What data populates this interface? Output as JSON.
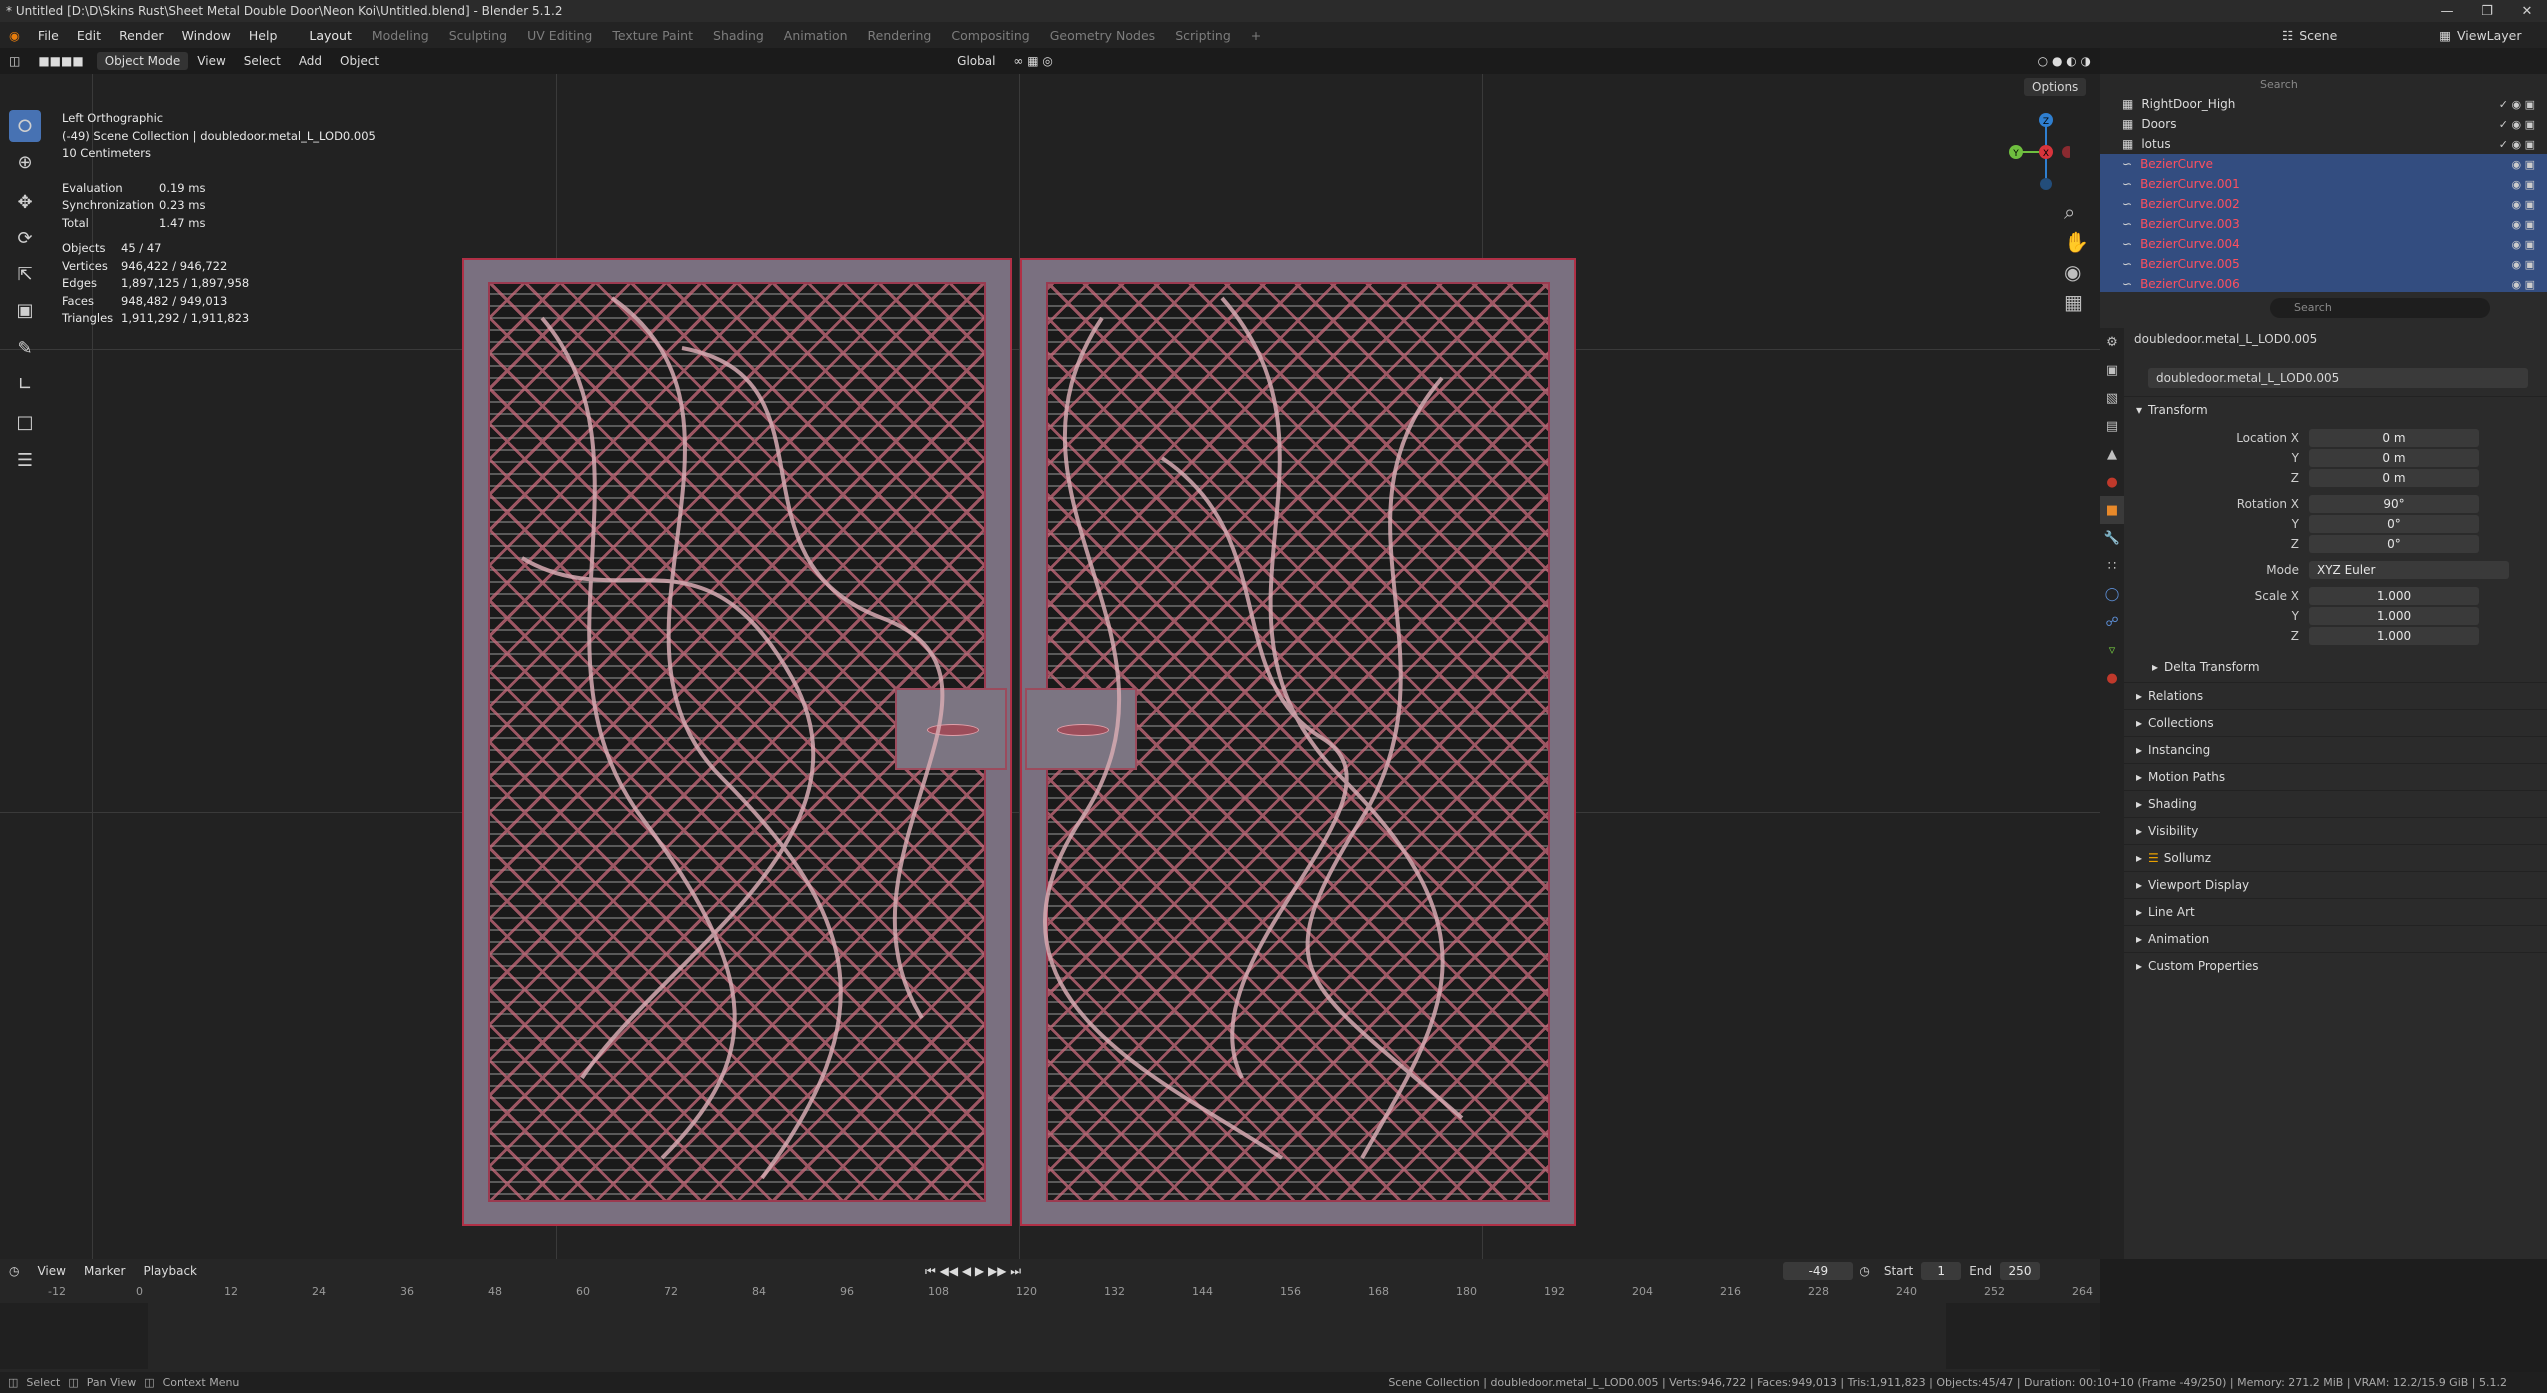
{
  "window": {
    "title": "* Untitled [D:\\D\\Skins Rust\\Sheet Metal Double Door\\Neon Koi\\Untitled.blend] - Blender 5.1.2"
  },
  "menus": [
    "File",
    "Edit",
    "Render",
    "Window",
    "Help"
  ],
  "workspaces": [
    "Layout",
    "Modeling",
    "Sculpting",
    "UV Editing",
    "Texture Paint",
    "Shading",
    "Animation",
    "Rendering",
    "Compositing",
    "Geometry Nodes",
    "Scripting"
  ],
  "active_workspace": "Layout",
  "scene": {
    "label": "Scene",
    "viewlayer": "ViewLayer"
  },
  "viewport_header": {
    "mode": "Object Mode",
    "menus": [
      "View",
      "Select",
      "Add",
      "Object"
    ],
    "orientation": "Global",
    "options": "Options"
  },
  "overlay": {
    "view_name": "Left Orthographic",
    "collection": "(-49) Scene Collection | doubledoor.metal_L_LOD0.005",
    "scale": "10 Centimeters",
    "timings": [
      {
        "k": "Evaluation",
        "v": "0.19 ms"
      },
      {
        "k": "Synchronization",
        "v": "0.23 ms"
      },
      {
        "k": "Total",
        "v": "1.47 ms"
      }
    ],
    "stats": [
      {
        "k": "Objects",
        "v": "45 / 47"
      },
      {
        "k": "Vertices",
        "v": "946,422 / 946,722"
      },
      {
        "k": "Edges",
        "v": "1,897,125 / 1,897,958"
      },
      {
        "k": "Faces",
        "v": "948,482 / 949,013"
      },
      {
        "k": "Triangles",
        "v": "1,911,292 / 1,911,823"
      }
    ]
  },
  "gizmo": {
    "z": "Z",
    "x": "X",
    "y": "Y"
  },
  "outliner": {
    "search_placeholder": "Search",
    "rows": [
      {
        "name": "RightDoor_High",
        "selected": false
      },
      {
        "name": "Doors",
        "selected": false
      },
      {
        "name": "lotus",
        "selected": false
      },
      {
        "name": "BezierCurve",
        "selected": true
      },
      {
        "name": "BezierCurve.001",
        "selected": true
      },
      {
        "name": "BezierCurve.002",
        "selected": true
      },
      {
        "name": "BezierCurve.003",
        "selected": true
      },
      {
        "name": "BezierCurve.004",
        "selected": true
      },
      {
        "name": "BezierCurve.005",
        "selected": true
      },
      {
        "name": "BezierCurve.006",
        "selected": true
      }
    ]
  },
  "properties": {
    "search_placeholder": "Search",
    "object_name": "doubledoor.metal_L_LOD0.005",
    "object_field": "doubledoor.metal_L_LOD0.005",
    "transform_label": "Transform",
    "location": {
      "label": "Location X",
      "x": "0 m",
      "y": "0 m",
      "z": "0 m"
    },
    "rotation": {
      "label": "Rotation X",
      "x": "90°",
      "y": "0°",
      "z": "0°"
    },
    "mode": {
      "label": "Mode",
      "value": "XYZ Euler"
    },
    "scale": {
      "label": "Scale X",
      "x": "1.000",
      "y": "1.000",
      "z": "1.000"
    },
    "axis_y": "Y",
    "axis_z": "Z",
    "panels": [
      "Delta Transform",
      "Relations",
      "Collections",
      "Instancing",
      "Motion Paths",
      "Shading",
      "Visibility",
      "Sollumz",
      "Viewport Display",
      "Line Art",
      "Animation",
      "Custom Properties"
    ]
  },
  "timeline": {
    "menus": [
      "View",
      "Marker",
      "Playback"
    ],
    "current_frame": "-49",
    "start_label": "Start",
    "start": "1",
    "end_label": "End",
    "end": "250",
    "ticks": [
      "-12",
      "0",
      "12",
      "24",
      "36",
      "48",
      "60",
      "72",
      "84",
      "96",
      "108",
      "120",
      "132",
      "144",
      "156",
      "168",
      "180",
      "192",
      "204",
      "216",
      "228",
      "240",
      "252",
      "264"
    ]
  },
  "statusbar": {
    "hints": [
      "Select",
      "Pan View",
      "Context Menu"
    ],
    "info": "Scene Collection | doubledoor.metal_L_LOD0.005 | Verts:946,722 | Faces:949,013 | Tris:1,911,823 | Objects:45/47 | Duration: 00:10+10 (Frame -49/250) | Memory: 271.2 MiB | VRAM: 12.2/15.9 GiB | 5.1.2"
  }
}
